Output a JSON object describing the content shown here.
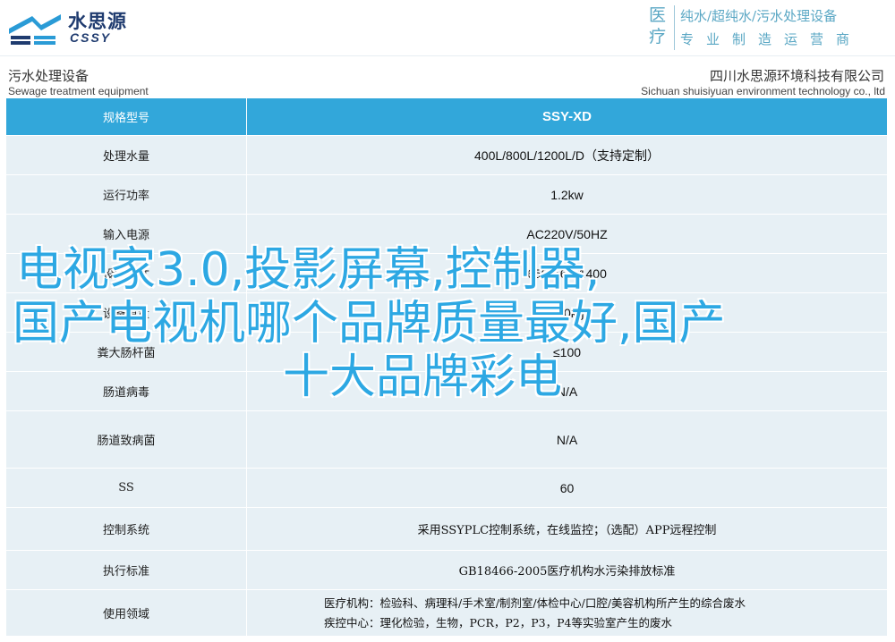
{
  "header": {
    "logo_cn": "水思源",
    "logo_en": "CSSY",
    "badge_top": "医",
    "badge_bottom": "疗",
    "slogan_line1": "纯水/超纯水/污水处理设备",
    "slogan_line2": "专业制造运营商"
  },
  "title_band": {
    "left_cn": "污水处理设备",
    "left_en": "Sewage treatment equipment",
    "right_cn": "四川水思源环境科技有限公司",
    "right_en": "Sichuan shuisiyuan environment technology co., ltd"
  },
  "table": {
    "header": {
      "label": "规格型号",
      "value": "SSY-XD"
    },
    "rows": [
      {
        "label": "处理水量",
        "value": "400L/800L/1200L/D（支持定制）"
      },
      {
        "label": "运行功率",
        "value": "1.2kw"
      },
      {
        "label": "输入电源",
        "value": "AC220V/50HZ"
      },
      {
        "label": "设备尺寸",
        "value": "650*560*1400"
      },
      {
        "label": "设备重量",
        "value": "350kg"
      },
      {
        "label": "粪大肠杆菌",
        "value": "≤100"
      },
      {
        "label": "肠道病毒",
        "value": "N/A"
      },
      {
        "label": "肠道致病菌",
        "value": "N/A"
      },
      {
        "label": "SS",
        "value": "60"
      },
      {
        "label": "控制系统",
        "value": "采用SSYPLC控制系统，在线监控；（选配）APP远程控制"
      },
      {
        "label": "执行标准",
        "value": "GB18466-2005医疗机构水污染排放标准"
      },
      {
        "label": "使用领域",
        "line1": "医疗机构：检验科、病理科/手术室/制剂室/体检中心/口腔/美容机构所产生的综合废水",
        "line2": "疾控中心：理化检验，生物，PCR，P2，P3，P4等实验室产生的废水"
      }
    ]
  },
  "overlay": {
    "line1": "电视家3.0,投影屏幕,控制器,",
    "line2": "国产电视机哪个品牌质量最好,国产",
    "line3": "十大品牌彩电"
  }
}
